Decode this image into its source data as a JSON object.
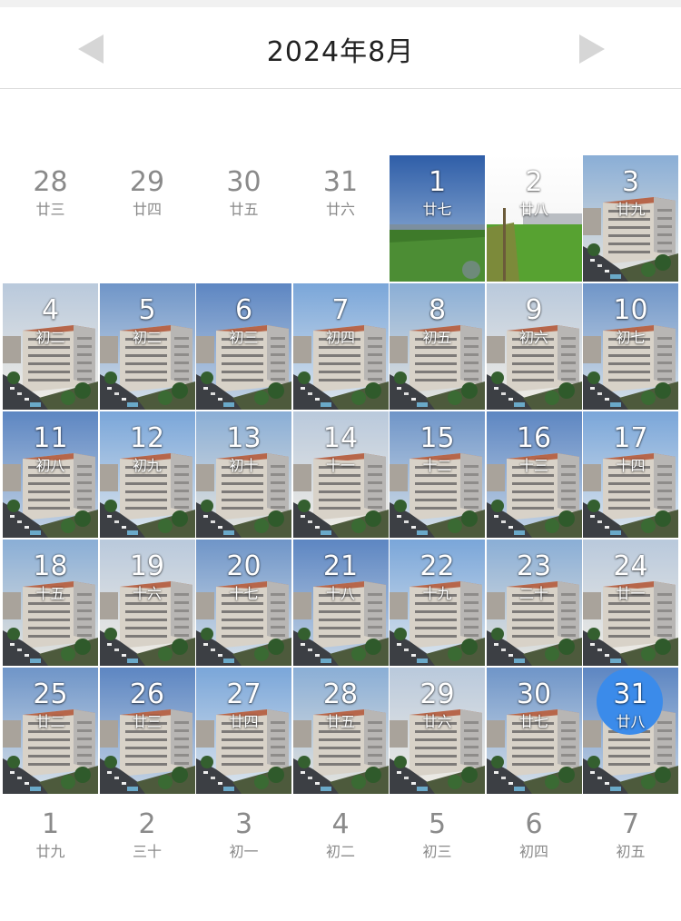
{
  "header": {
    "title": "2024年8月",
    "prev_icon": "triangle-left-icon",
    "next_icon": "triangle-right-icon",
    "arrow_color": "#d6d6d6"
  },
  "leading_days": [
    {
      "day": "28",
      "lunar": "廿三"
    },
    {
      "day": "29",
      "lunar": "廿四"
    },
    {
      "day": "30",
      "lunar": "廿五"
    },
    {
      "day": "31",
      "lunar": "廿六"
    }
  ],
  "month_days": [
    {
      "day": "1",
      "lunar": "廿七",
      "scene": "field"
    },
    {
      "day": "2",
      "lunar": "廿八",
      "scene": "field2"
    },
    {
      "day": "3",
      "lunar": "廿九",
      "scene": "building"
    },
    {
      "day": "4",
      "lunar": "初二",
      "scene": "building"
    },
    {
      "day": "5",
      "lunar": "初二",
      "scene": "building"
    },
    {
      "day": "6",
      "lunar": "初三",
      "scene": "building"
    },
    {
      "day": "7",
      "lunar": "初四",
      "scene": "building"
    },
    {
      "day": "8",
      "lunar": "初五",
      "scene": "building"
    },
    {
      "day": "9",
      "lunar": "初六",
      "scene": "building"
    },
    {
      "day": "10",
      "lunar": "初七",
      "scene": "building"
    },
    {
      "day": "11",
      "lunar": "初八",
      "scene": "building"
    },
    {
      "day": "12",
      "lunar": "初九",
      "scene": "building"
    },
    {
      "day": "13",
      "lunar": "初十",
      "scene": "building"
    },
    {
      "day": "14",
      "lunar": "十一",
      "scene": "building"
    },
    {
      "day": "15",
      "lunar": "十二",
      "scene": "building"
    },
    {
      "day": "16",
      "lunar": "十三",
      "scene": "building"
    },
    {
      "day": "17",
      "lunar": "十四",
      "scene": "building"
    },
    {
      "day": "18",
      "lunar": "十五",
      "scene": "building"
    },
    {
      "day": "19",
      "lunar": "十六",
      "scene": "building"
    },
    {
      "day": "20",
      "lunar": "十七",
      "scene": "building"
    },
    {
      "day": "21",
      "lunar": "十八",
      "scene": "building"
    },
    {
      "day": "22",
      "lunar": "十九",
      "scene": "building"
    },
    {
      "day": "23",
      "lunar": "二十",
      "scene": "building"
    },
    {
      "day": "24",
      "lunar": "廿一",
      "scene": "building"
    },
    {
      "day": "25",
      "lunar": "廿二",
      "scene": "building"
    },
    {
      "day": "26",
      "lunar": "廿三",
      "scene": "building"
    },
    {
      "day": "27",
      "lunar": "廿四",
      "scene": "building"
    },
    {
      "day": "28",
      "lunar": "廿五",
      "scene": "building"
    },
    {
      "day": "29",
      "lunar": "廿六",
      "scene": "building"
    },
    {
      "day": "30",
      "lunar": "廿七",
      "scene": "building"
    },
    {
      "day": "31",
      "lunar": "廿八",
      "scene": "building",
      "today": true
    }
  ],
  "trailing_days": [
    {
      "day": "1",
      "lunar": "廿九"
    },
    {
      "day": "2",
      "lunar": "三十"
    },
    {
      "day": "3",
      "lunar": "初一"
    },
    {
      "day": "4",
      "lunar": "初二"
    },
    {
      "day": "5",
      "lunar": "初三"
    },
    {
      "day": "6",
      "lunar": "初四"
    },
    {
      "day": "7",
      "lunar": "初五"
    }
  ],
  "colors": {
    "today_circle": "#3b8bea",
    "muted_text": "#8a8a8a",
    "title_text": "#222222"
  }
}
